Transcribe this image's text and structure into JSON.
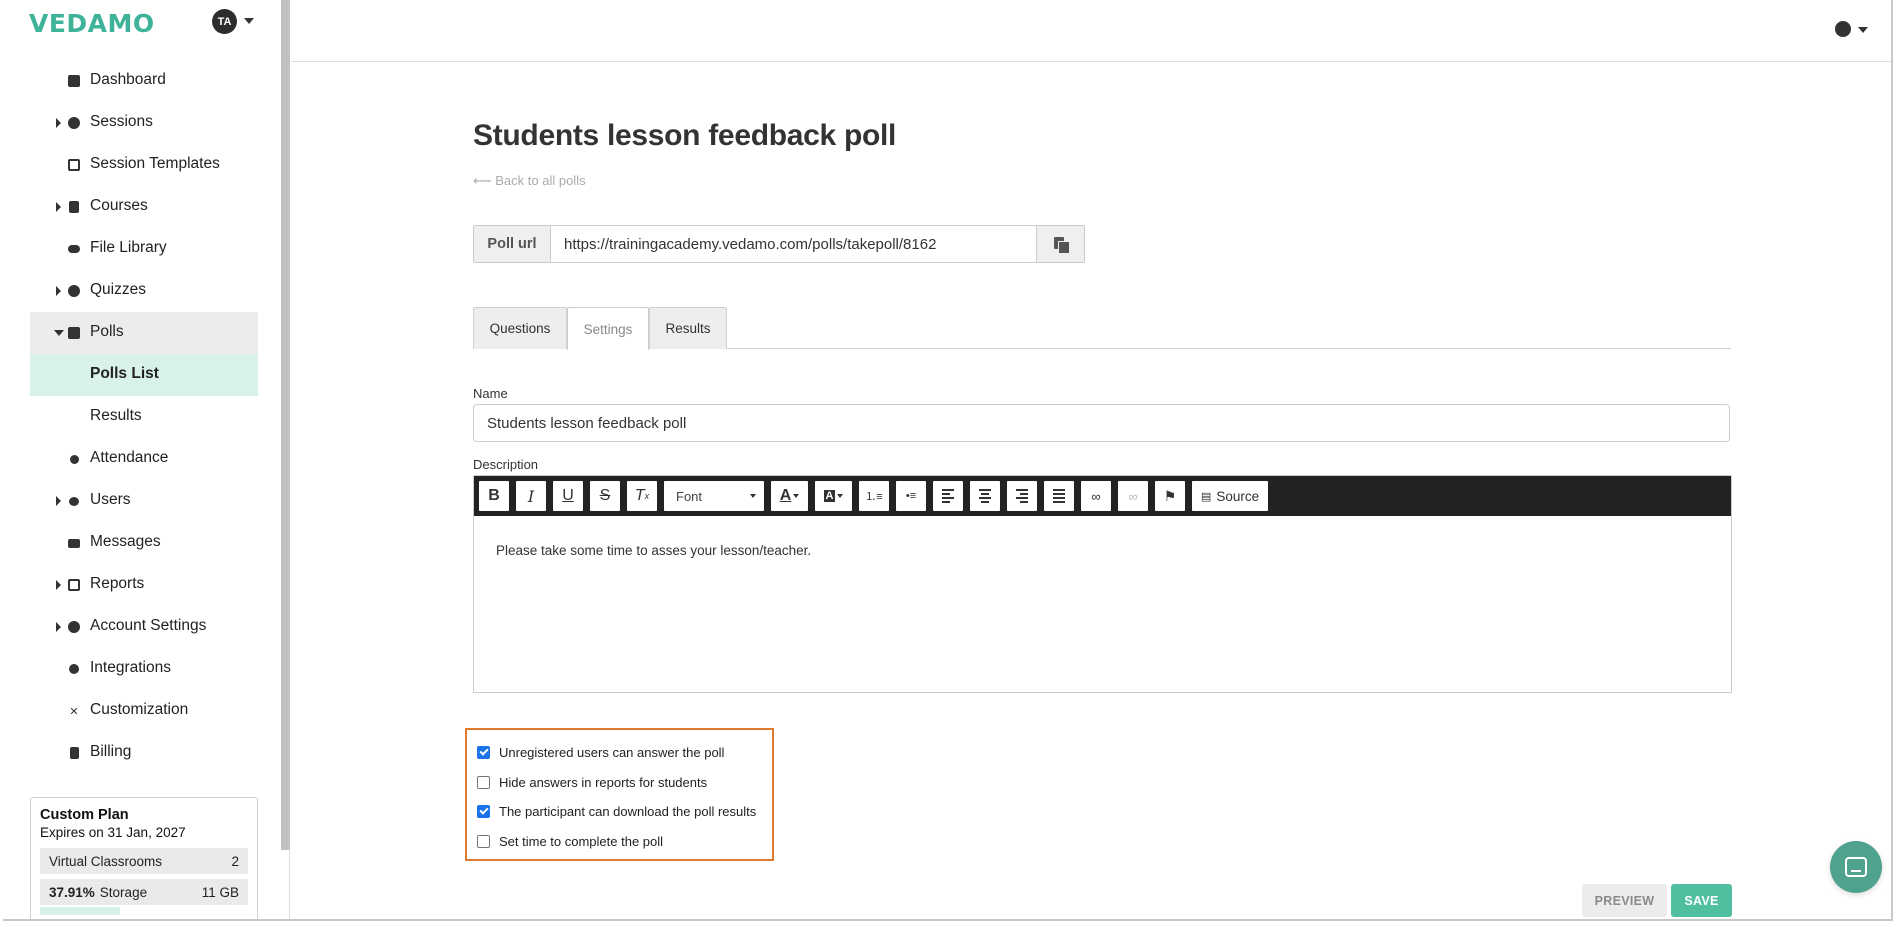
{
  "sidebar": {
    "brand": "VEDAMO",
    "avatar_initials": "TA",
    "items": [
      {
        "label": "Dashboard"
      },
      {
        "label": "Sessions"
      },
      {
        "label": "Session Templates"
      },
      {
        "label": "Courses"
      },
      {
        "label": "File Library"
      },
      {
        "label": "Quizzes"
      },
      {
        "label": "Polls"
      },
      {
        "label": "Polls List"
      },
      {
        "label": "Results"
      },
      {
        "label": "Attendance"
      },
      {
        "label": "Users"
      },
      {
        "label": "Messages"
      },
      {
        "label": "Reports"
      },
      {
        "label": "Account Settings"
      },
      {
        "label": "Integrations"
      },
      {
        "label": "Customization"
      },
      {
        "label": "Billing"
      }
    ],
    "plan": {
      "title": "Custom Plan",
      "expires": "Expires on 31 Jan, 2027",
      "virtual_label": "Virtual Classrooms",
      "virtual_count": "2",
      "storage_percent": "37.91%",
      "storage_label": "Storage",
      "storage_size": "11 GB"
    }
  },
  "page": {
    "title": "Students lesson feedback poll",
    "back_link": "⟵ Back to all polls",
    "poll_url_label": "Poll url",
    "poll_url": "https://trainingacademy.vedamo.com/polls/takepoll/8162",
    "tabs": [
      "Questions",
      "Settings",
      "Results"
    ],
    "active_tab": "Settings",
    "name_label": "Name",
    "name_value": "Students lesson feedback poll",
    "description_label": "Description",
    "description_text": "Please take some time to asses your lesson/teacher.",
    "toolbar": {
      "font_label": "Font",
      "source_label": "Source"
    },
    "options": [
      {
        "label": "Unregistered users can answer the poll",
        "checked": true
      },
      {
        "label": "Hide answers in reports for students",
        "checked": false
      },
      {
        "label": "The participant can download the poll results",
        "checked": true
      },
      {
        "label": "Set time to complete the poll",
        "checked": false
      }
    ],
    "preview_label": "PREVIEW",
    "save_label": "SAVE"
  },
  "colors": {
    "brand": "#3fb39a",
    "active_nav": "#d9f2e9",
    "save": "#4fbf9f",
    "highlight_border": "#e07a2e",
    "checkbox": "#1a73e8"
  }
}
